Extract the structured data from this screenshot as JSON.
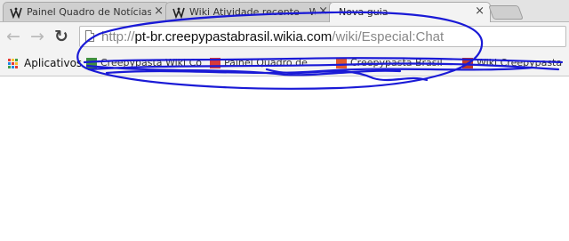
{
  "tabs": [
    {
      "title": "Painel Quadro de Notícias",
      "close": "×",
      "active": false
    },
    {
      "title": "Wiki Atividade recente - W",
      "close": "×",
      "active": false
    },
    {
      "title": "Nova guia",
      "close": "×",
      "active": true
    }
  ],
  "toolbar": {
    "back_icon": "←",
    "forward_icon": "→",
    "reload_icon": "↻",
    "url_scheme": "http://",
    "url_host": "pt-br.creepypastabrasil.wikia.com",
    "url_path": "/wiki/Especial:Chat"
  },
  "bookmarks": {
    "apps_label": "Aplicativos",
    "items": [
      {
        "label": "Creepypasta Wiki Co",
        "color": "#3f8f3f"
      },
      {
        "label": "Painel Quadro de",
        "color": "#d83a3a"
      },
      {
        "label": "Creepypasta Brasil",
        "color": "#e2572c"
      },
      {
        "label": "Wiki Creepypasta",
        "color": "#c0392b"
      }
    ]
  },
  "colors": {
    "scribble": "#1a1ad6",
    "tab_strip": "#e3e3e3",
    "toolbar": "#f3f3f3"
  }
}
